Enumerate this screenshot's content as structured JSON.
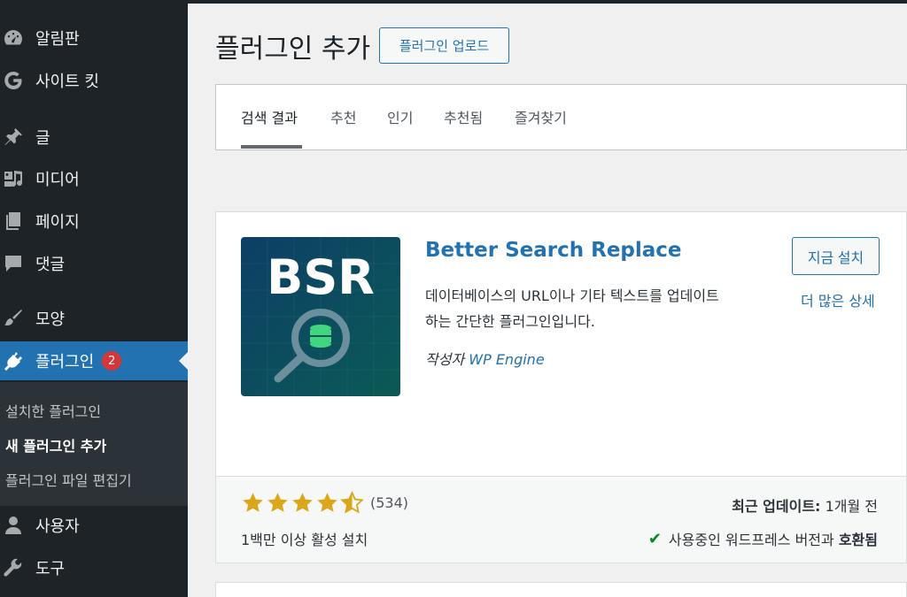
{
  "sidebar": {
    "items": [
      {
        "label": "알림판",
        "icon": "dashboard-icon"
      },
      {
        "label": "사이트 킷",
        "icon": "google-g-icon"
      },
      {
        "label": "글",
        "icon": "pushpin-icon"
      },
      {
        "label": "미디어",
        "icon": "media-icon"
      },
      {
        "label": "페이지",
        "icon": "pages-icon"
      },
      {
        "label": "댓글",
        "icon": "comment-icon"
      },
      {
        "label": "모양",
        "icon": "appearance-brush-icon"
      },
      {
        "label": "플러그인",
        "icon": "plugin-icon",
        "badge": "2"
      },
      {
        "label": "사용자",
        "icon": "user-icon"
      },
      {
        "label": "도구",
        "icon": "wrench-icon"
      }
    ],
    "submenu": [
      "설치한 플러그인",
      "새 플러그인 추가",
      "플러그인 파일 편집기"
    ]
  },
  "header": {
    "title": "플러그인 추가",
    "upload_label": "플러그인 업로드"
  },
  "tabs": [
    "검색 결과",
    "추천",
    "인기",
    "추천됨",
    "즐겨찾기"
  ],
  "plugin": {
    "name": "Better Search Replace",
    "description": "데이터베이스의 URL이나 기타 텍스트를 업데이트하는 간단한 플러그인입니다.",
    "author_prefix": "작성자",
    "author": "WP Engine",
    "install_label": "지금 설치",
    "more_details": "더 많은 상세",
    "rating": 4.5,
    "rating_count": "(534)",
    "installs": "1백만 이상 활성 설치",
    "last_updated_label": "최근 업데이트:",
    "last_updated_value": "1개월 전",
    "compat_prefix": "사용중인 워드프레스 버전과",
    "compat_status": "호환됨",
    "icon_text": "BSR"
  },
  "colors": {
    "accent": "#2271b1",
    "sidebar_bg": "#1d2327",
    "star": "#dba617",
    "badge": "#d63638",
    "check": "#008a20"
  }
}
